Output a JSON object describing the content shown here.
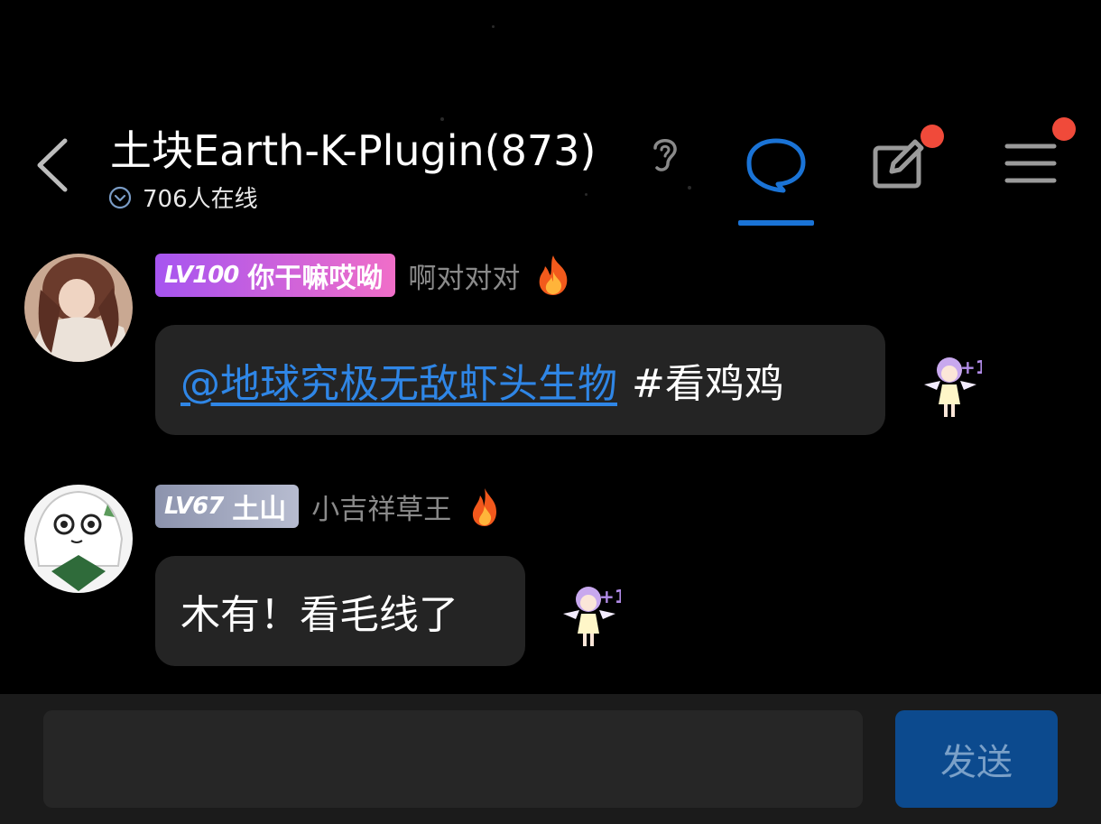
{
  "header": {
    "title": "土块Earth-K-Plugin(873)",
    "online_text": "706人在线",
    "tabs": [
      {
        "name": "chat",
        "active": true
      },
      {
        "name": "post",
        "has_badge": true
      }
    ],
    "menu_has_badge": true
  },
  "messages": [
    {
      "level": "LV100",
      "badge_title": "你干嘛哎呦",
      "badge_style": "purple",
      "username": "啊对对对",
      "mention": "@地球究极无敌虾头生物",
      "text": "#看鸡鸡",
      "reaction": "+1"
    },
    {
      "level": "LV67",
      "badge_title": "土山",
      "badge_style": "gray",
      "username": "小吉祥草王",
      "mention": "",
      "text": "木有！看毛线了",
      "reaction": "+1"
    }
  ],
  "composer": {
    "input_value": "",
    "placeholder": "",
    "send_label": "发送"
  },
  "colors": {
    "accent": "#1a73d6",
    "mention": "#2f86e6",
    "badge_dot": "#f04a3a",
    "bubble": "#242424",
    "send_button": "#0c4a8e"
  }
}
